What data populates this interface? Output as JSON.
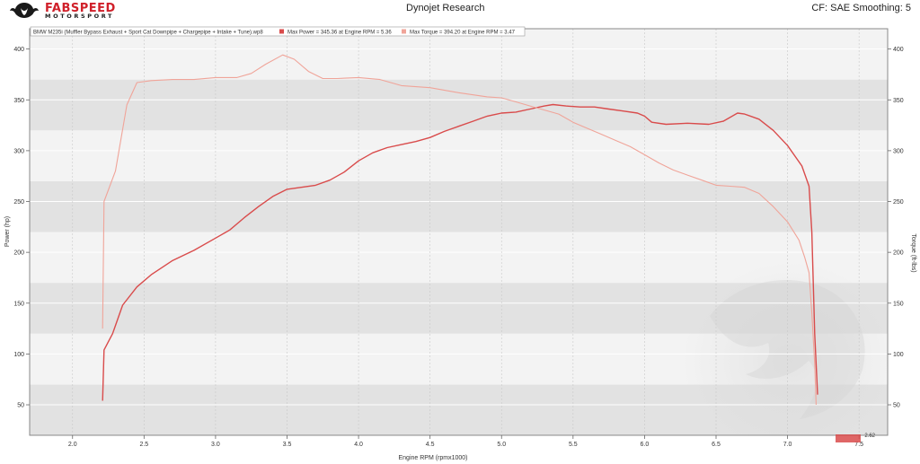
{
  "header": {
    "brand": "FABSPEED",
    "brand_sub": "MOTORSPORT",
    "title": "Dynojet Research",
    "right_text": "CF: SAE Smoothing: 5"
  },
  "legend": {
    "run_name": "BMW M235i (Muffler Bypass Exhaust + Sport Cat Downpipe + Chargepipe + Intake + Tune).wp8",
    "max_power": "Max Power = 345.36 at Engine RPM = 5.36",
    "max_torque": "Max Torque = 394.20 at Engine RPM = 3.47"
  },
  "footer": {
    "version": "2.62"
  },
  "colors": {
    "power": "#d94b4b",
    "torque": "#f0a499",
    "band_dark": "#e2e2e2",
    "band_light": "#f3f3f3"
  },
  "chart_data": {
    "type": "line",
    "xlabel": "Engine RPM (rpmx1000)",
    "ylabel_left": "Power (hp)",
    "ylabel_right": "Torque (ft-lbs)",
    "xlim": [
      1.7,
      7.7
    ],
    "ylim": [
      20,
      420
    ],
    "x_ticks": [
      "2.0",
      "2.5",
      "3.0",
      "3.5",
      "4.0",
      "4.5",
      "5.0",
      "5.5",
      "6.0",
      "6.5",
      "7.0",
      "7.5"
    ],
    "y_ticks": [
      "50",
      "100",
      "150",
      "200",
      "250",
      "300",
      "350",
      "400"
    ],
    "grid": true,
    "series": [
      {
        "name": "Power",
        "points": [
          [
            2.21,
            54
          ],
          [
            2.22,
            104
          ],
          [
            2.28,
            120
          ],
          [
            2.35,
            148
          ],
          [
            2.45,
            166
          ],
          [
            2.55,
            178
          ],
          [
            2.7,
            192
          ],
          [
            2.85,
            202
          ],
          [
            3.0,
            214
          ],
          [
            3.1,
            222
          ],
          [
            3.2,
            234
          ],
          [
            3.3,
            245
          ],
          [
            3.4,
            255
          ],
          [
            3.5,
            262
          ],
          [
            3.6,
            264
          ],
          [
            3.7,
            266
          ],
          [
            3.8,
            271
          ],
          [
            3.9,
            279
          ],
          [
            4.0,
            290
          ],
          [
            4.1,
            298
          ],
          [
            4.2,
            303
          ],
          [
            4.3,
            306
          ],
          [
            4.4,
            309
          ],
          [
            4.5,
            313
          ],
          [
            4.6,
            319
          ],
          [
            4.7,
            324
          ],
          [
            4.8,
            329
          ],
          [
            4.9,
            334
          ],
          [
            5.0,
            337
          ],
          [
            5.1,
            338
          ],
          [
            5.2,
            341
          ],
          [
            5.3,
            344
          ],
          [
            5.36,
            345.4
          ],
          [
            5.45,
            344
          ],
          [
            5.55,
            343
          ],
          [
            5.65,
            343
          ],
          [
            5.75,
            341
          ],
          [
            5.85,
            339
          ],
          [
            5.95,
            337
          ],
          [
            6.0,
            334
          ],
          [
            6.05,
            328
          ],
          [
            6.15,
            326
          ],
          [
            6.3,
            327
          ],
          [
            6.45,
            326
          ],
          [
            6.55,
            329
          ],
          [
            6.65,
            337
          ],
          [
            6.7,
            336
          ],
          [
            6.8,
            331
          ],
          [
            6.9,
            320
          ],
          [
            7.0,
            305
          ],
          [
            7.1,
            285
          ],
          [
            7.15,
            265
          ],
          [
            7.17,
            220
          ],
          [
            7.19,
            120
          ],
          [
            7.21,
            60
          ]
        ]
      },
      {
        "name": "Torque",
        "points": [
          [
            2.21,
            125
          ],
          [
            2.22,
            250
          ],
          [
            2.3,
            280
          ],
          [
            2.38,
            345
          ],
          [
            2.45,
            367
          ],
          [
            2.55,
            369
          ],
          [
            2.7,
            370
          ],
          [
            2.85,
            370
          ],
          [
            3.0,
            372
          ],
          [
            3.15,
            372
          ],
          [
            3.25,
            376
          ],
          [
            3.35,
            385
          ],
          [
            3.47,
            394.2
          ],
          [
            3.55,
            390
          ],
          [
            3.65,
            378
          ],
          [
            3.75,
            371
          ],
          [
            3.85,
            371
          ],
          [
            4.0,
            372
          ],
          [
            4.15,
            370
          ],
          [
            4.3,
            364
          ],
          [
            4.5,
            362
          ],
          [
            4.7,
            357
          ],
          [
            4.9,
            353
          ],
          [
            5.0,
            352
          ],
          [
            5.1,
            348
          ],
          [
            5.2,
            344
          ],
          [
            5.3,
            340
          ],
          [
            5.4,
            336
          ],
          [
            5.5,
            328
          ],
          [
            5.6,
            322
          ],
          [
            5.7,
            316
          ],
          [
            5.8,
            310
          ],
          [
            5.9,
            304
          ],
          [
            6.0,
            296
          ],
          [
            6.1,
            288
          ],
          [
            6.2,
            281
          ],
          [
            6.3,
            276
          ],
          [
            6.4,
            271
          ],
          [
            6.5,
            266
          ],
          [
            6.6,
            265
          ],
          [
            6.7,
            264
          ],
          [
            6.8,
            258
          ],
          [
            6.9,
            245
          ],
          [
            7.0,
            230
          ],
          [
            7.08,
            212
          ],
          [
            7.12,
            195
          ],
          [
            7.15,
            180
          ],
          [
            7.17,
            140
          ],
          [
            7.19,
            90
          ],
          [
            7.2,
            50
          ]
        ]
      }
    ]
  }
}
